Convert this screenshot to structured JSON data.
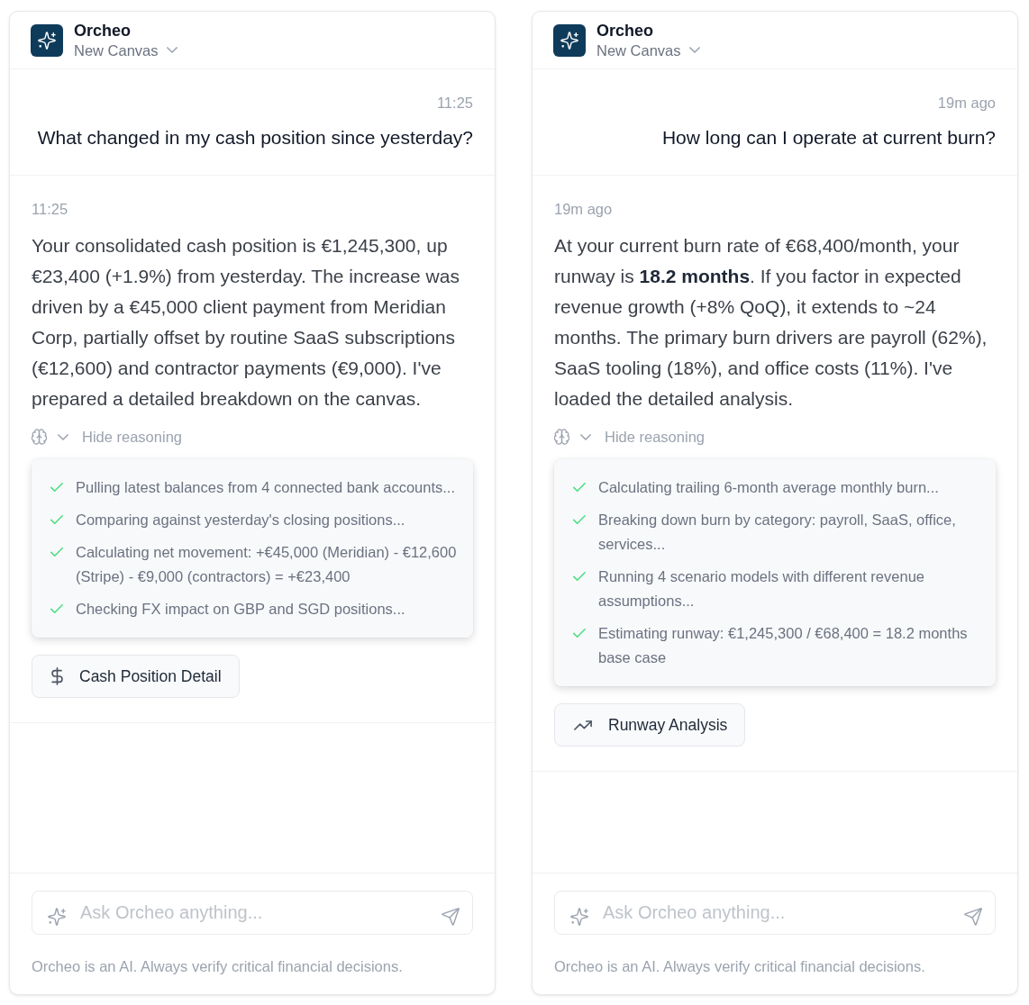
{
  "panels": [
    {
      "header": {
        "title": "Orcheo",
        "canvas": "New Canvas"
      },
      "user_message": {
        "time": "11:25",
        "text": "What changed in my cash position since yesterday?"
      },
      "assistant_message": {
        "time": "11:25",
        "text": "Your consolidated cash position is €1,245,300, up €23,400 (+1.9%) from yesterday. The increase was driven by a €45,000 client payment from Meridian Corp, partially offset by routine SaaS subscriptions (€12,600) and contractor payments (€9,000). I've prepared a detailed breakdown on the canvas.",
        "reasoning": {
          "label": "Hide reasoning",
          "expanded": true,
          "steps": [
            {
              "text": "Pulling latest balances from 4 connected bank accounts...",
              "done": true
            },
            {
              "text": "Comparing against yesterday's closing positions...",
              "done": true
            },
            {
              "text": "Calculating net movement: +€45,000 (Meridian) - €12,600 (Stripe) - €9,000 (contractors) = +€23,400",
              "done": true
            },
            {
              "text": "Checking FX impact on GBP and SGD positions...",
              "done": true
            }
          ]
        },
        "artifact": {
          "kind": "dollar",
          "label": "Cash Position Detail"
        }
      },
      "composer": {
        "placeholder": "Ask Orcheo anything..."
      },
      "disclaimer": "Orcheo is an AI. Always verify critical financial decisions."
    },
    {
      "header": {
        "title": "Orcheo",
        "canvas": "New Canvas"
      },
      "user_message": {
        "time": "19m ago",
        "text": "How long can I operate at current burn?"
      },
      "assistant_message": {
        "time": "19m ago",
        "text": "At your current burn rate of €68,400/month, your runway is **18.2 months**. If you factor in expected revenue growth (+8% QoQ), it extends to ~24 months. The primary burn drivers are payroll (62%), SaaS tooling (18%), and office costs (11%). I've loaded the detailed analysis.",
        "reasoning": {
          "label": "Hide reasoning",
          "expanded": true,
          "steps": [
            {
              "text": "Calculating trailing 6-month average monthly burn...",
              "done": true
            },
            {
              "text": "Breaking down burn by category: payroll, SaaS, office, services...",
              "done": true
            },
            {
              "text": "Running 4 scenario models with different revenue assumptions...",
              "done": true
            },
            {
              "text": "Estimating runway: €1,245,300 / €68,400 = 18.2 months base case",
              "done": true
            }
          ]
        },
        "artifact": {
          "kind": "trend",
          "label": "Runway Analysis"
        }
      },
      "composer": {
        "placeholder": "Ask Orcheo anything..."
      },
      "disclaimer": "Orcheo is an AI. Always verify critical financial decisions."
    }
  ]
}
